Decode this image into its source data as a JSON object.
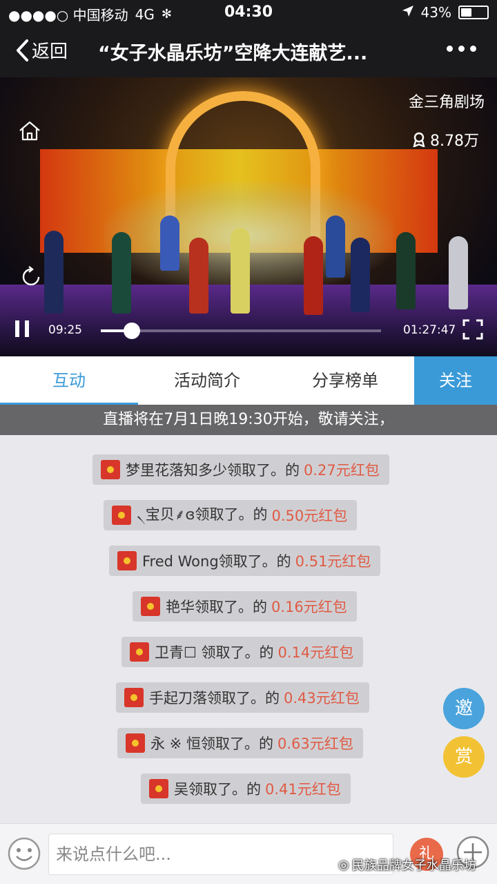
{
  "status": {
    "carrier": "●●●●○ 中国移动",
    "network": "4G",
    "time": "04:30",
    "battery": "43%",
    "battery_level": 0.43
  },
  "nav": {
    "back": "返回",
    "title": "“女子水晶乐坊”空降大连献艺..."
  },
  "video": {
    "venue": "金三角剧场",
    "viewers": "8.78万",
    "current_time": "09:25",
    "total_time": "01:27:47",
    "progress": 0.11
  },
  "tabs": [
    {
      "label": "互动"
    },
    {
      "label": "活动简介"
    },
    {
      "label": "分享榜单"
    }
  ],
  "follow": "关注",
  "notice": "直播将在7月1日晚19:30开始，敬请关注，",
  "messages": [
    {
      "text": "梦里花落知多少领取了。的",
      "amount": "0.27元红包"
    },
    {
      "text": "৲﻿宝贝﻿⸙ɞ领取了。的",
      "amount": "0.50元红包"
    },
    {
      "text": "Fred Wong领取了。的",
      "amount": "0.51元红包"
    },
    {
      "text": "艳华领取了。的",
      "amount": "0.16元红包"
    },
    {
      "text": "卫青☐ 领取了。的",
      "amount": "0.14元红包"
    },
    {
      "text": "手起刀落领取了。的",
      "amount": "0.43元红包"
    },
    {
      "text": "永 ※ 恒领取了。的",
      "amount": "0.63元红包"
    },
    {
      "text": "吴领取了。的",
      "amount": "0.41元红包"
    }
  ],
  "invite": "邀",
  "reward": "赏",
  "input_placeholder": "来说点什么吧...",
  "gift": "礼",
  "watermark": "民族品牌女子水晶乐坊",
  "colors": {
    "accent": "#3a9ad8",
    "amount": "#e05a44",
    "envelope": "#d8362a",
    "invite": "#4aa3dc",
    "reward": "#f2c234"
  }
}
